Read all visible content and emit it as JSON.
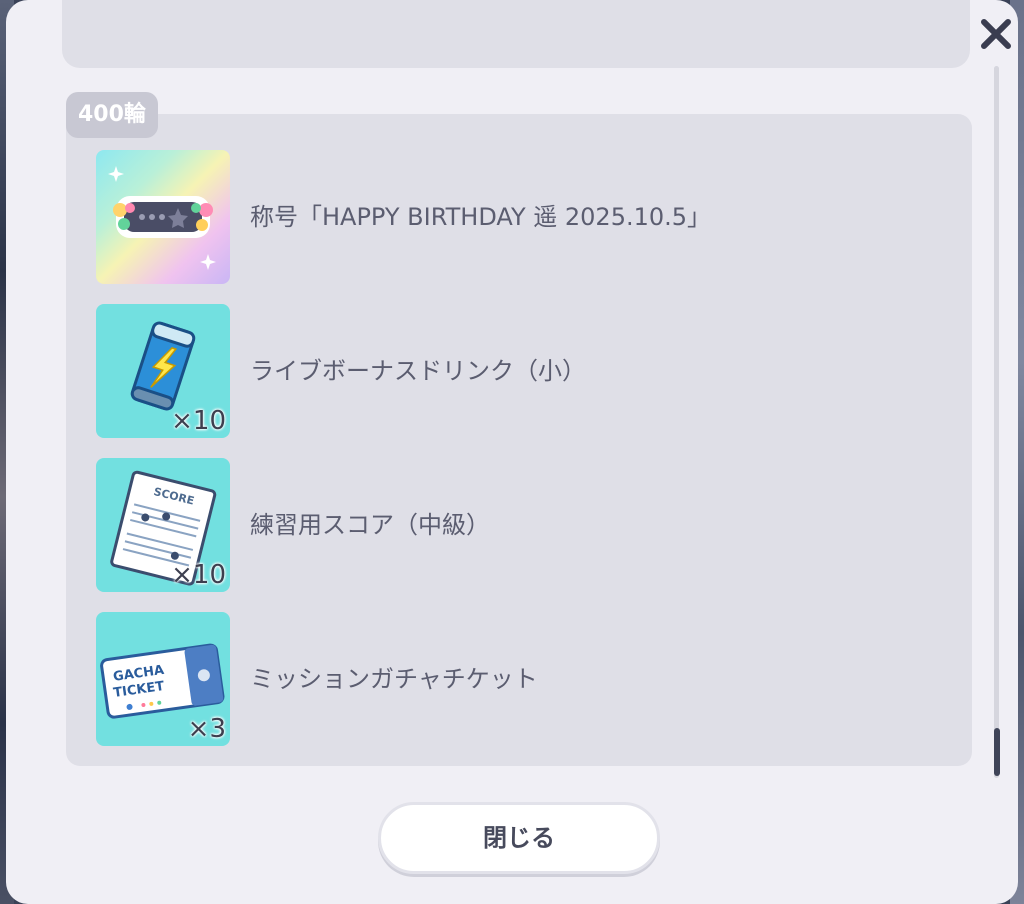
{
  "dialog": {
    "close_icon": "close-x-icon",
    "close_button_label": "閉じる"
  },
  "reward_group": {
    "tag": "400輪",
    "items": [
      {
        "name": "称号「HAPPY BIRTHDAY 遥 2025.10.5」",
        "quantity": "",
        "icon": "title-plate-icon"
      },
      {
        "name": "ライブボーナスドリンク（小）",
        "quantity": "×10",
        "icon": "energy-drink-can-icon"
      },
      {
        "name": "練習用スコア（中級）",
        "quantity": "×10",
        "icon": "score-sheet-icon"
      },
      {
        "name": "ミッションガチャチケット",
        "quantity": "×3",
        "icon": "gacha-ticket-icon"
      }
    ]
  },
  "colors": {
    "modal_bg": "#f0eff5",
    "panel_bg": "#dfdfe7",
    "item_bg": "#72e0e0",
    "text": "#5b5d70"
  }
}
